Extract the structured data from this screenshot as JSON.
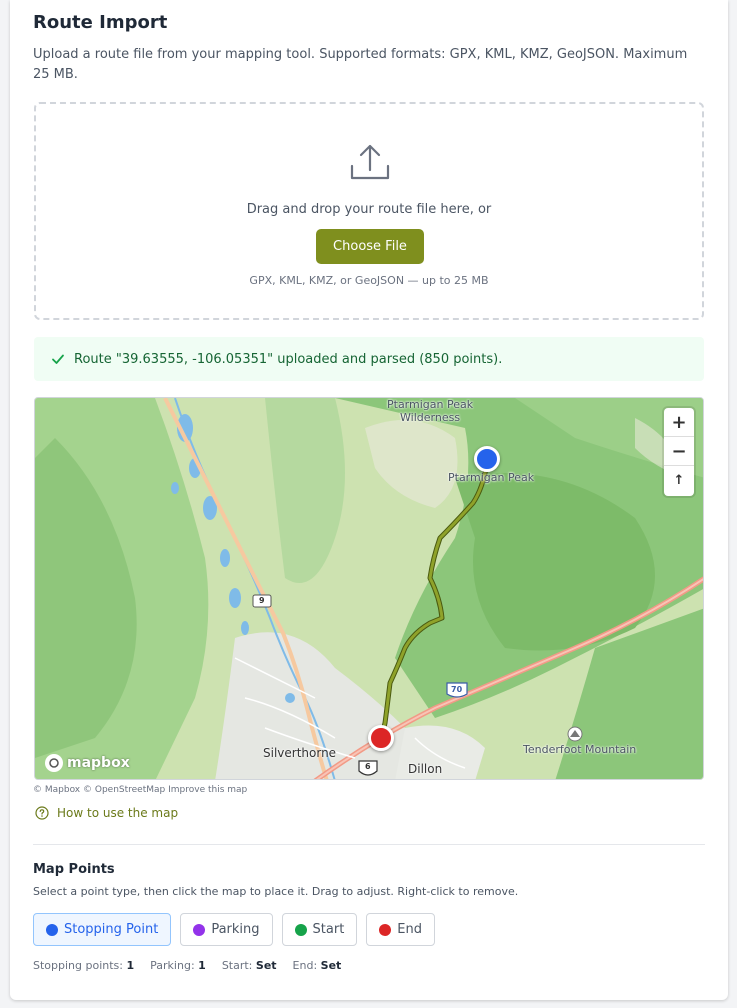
{
  "header": {
    "title": "Route Import",
    "description": "Upload a route file from your mapping tool. Supported formats: GPX, KML, KMZ, GeoJSON. Maximum 25 MB."
  },
  "dropzone": {
    "instruction": "Drag and drop your route file here, or",
    "button_label": "Choose File",
    "hint": "GPX, KML, KMZ, or GeoJSON — up to 25 MB"
  },
  "status": {
    "message": "Route \"39.63555, -106.05351\" uploaded and parsed (850 points).",
    "color": "#166534"
  },
  "map": {
    "labels": {
      "wilderness": "Ptarmigan Peak\nWilderness",
      "peak": "Ptarmigan Peak",
      "town1": "Silverthorne",
      "town2": "Dillon",
      "mountain": "Tenderfoot Mountain",
      "hwy9": "9",
      "i70": "70",
      "us6": "6"
    },
    "controls": {
      "zoom_in": "+",
      "zoom_out": "−",
      "reset_north": "↑"
    },
    "logo": "mapbox",
    "route_color": "#7f8f1e",
    "start_marker_color": "#2563eb",
    "end_marker_color": "#dc2626"
  },
  "attribution": {
    "mapbox": "© Mapbox",
    "osm": "© OpenStreetMap",
    "improve": "Improve this map"
  },
  "help_link": "How to use the map",
  "map_points": {
    "title": "Map Points",
    "description": "Select a point type, then click the map to place it. Drag to adjust. Right-click to remove.",
    "types": [
      {
        "label": "Stopping Point",
        "color": "#2563eb",
        "active": true
      },
      {
        "label": "Parking",
        "color": "#9333ea",
        "active": false
      },
      {
        "label": "Start",
        "color": "#16a34a",
        "active": false
      },
      {
        "label": "End",
        "color": "#dc2626",
        "active": false
      }
    ],
    "counts": {
      "stopping_label": "Stopping points:",
      "stopping_value": "1",
      "parking_label": "Parking:",
      "parking_value": "1",
      "start_label": "Start:",
      "start_value": "Set",
      "end_label": "End:",
      "end_value": "Set"
    }
  }
}
